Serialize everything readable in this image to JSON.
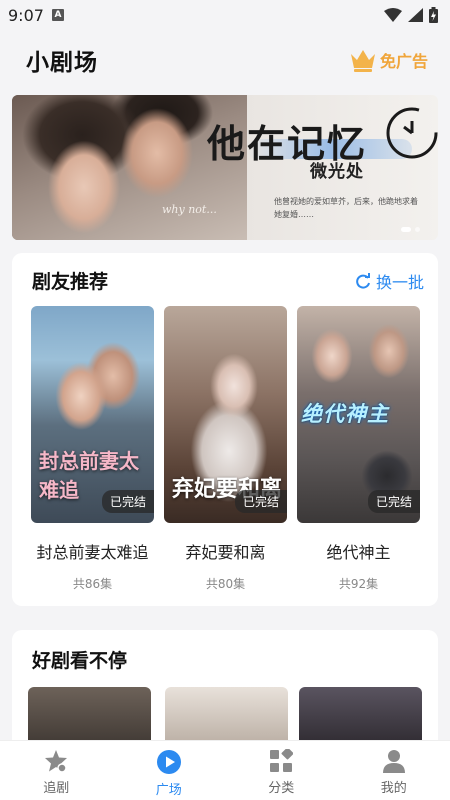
{
  "status_bar": {
    "time": "9:07",
    "notification_glyph": "A"
  },
  "header": {
    "title": "小剧场",
    "vip_label": "免广告"
  },
  "banner": {
    "title": "他在记忆",
    "subtitle": "微光处",
    "script_text": "why not...",
    "caption": "他曾视她的爱如草芥，后来，他跪地求着她复婚……"
  },
  "recommend": {
    "title": "剧友推荐",
    "refresh_label": "换一批",
    "items": [
      {
        "name": "封总前妻太难追",
        "poster_text": "封总前妻太难追",
        "badge": "已完结",
        "episodes": "共86集"
      },
      {
        "name": "弃妃要和离",
        "poster_text": "弃妃要和离",
        "badge": "已完结",
        "episodes": "共80集"
      },
      {
        "name": "绝代神主",
        "poster_text": "绝代神主",
        "badge": "已完结",
        "episodes": "共92集"
      }
    ]
  },
  "binge": {
    "title": "好剧看不停"
  },
  "nav": {
    "items": [
      {
        "label": "追剧",
        "icon": "star-icon"
      },
      {
        "label": "广场",
        "icon": "play-icon",
        "active": true
      },
      {
        "label": "分类",
        "icon": "category-icon"
      },
      {
        "label": "我的",
        "icon": "person-icon"
      }
    ]
  },
  "colors": {
    "accent": "#2c8af0",
    "vip": "#f0a53a"
  }
}
